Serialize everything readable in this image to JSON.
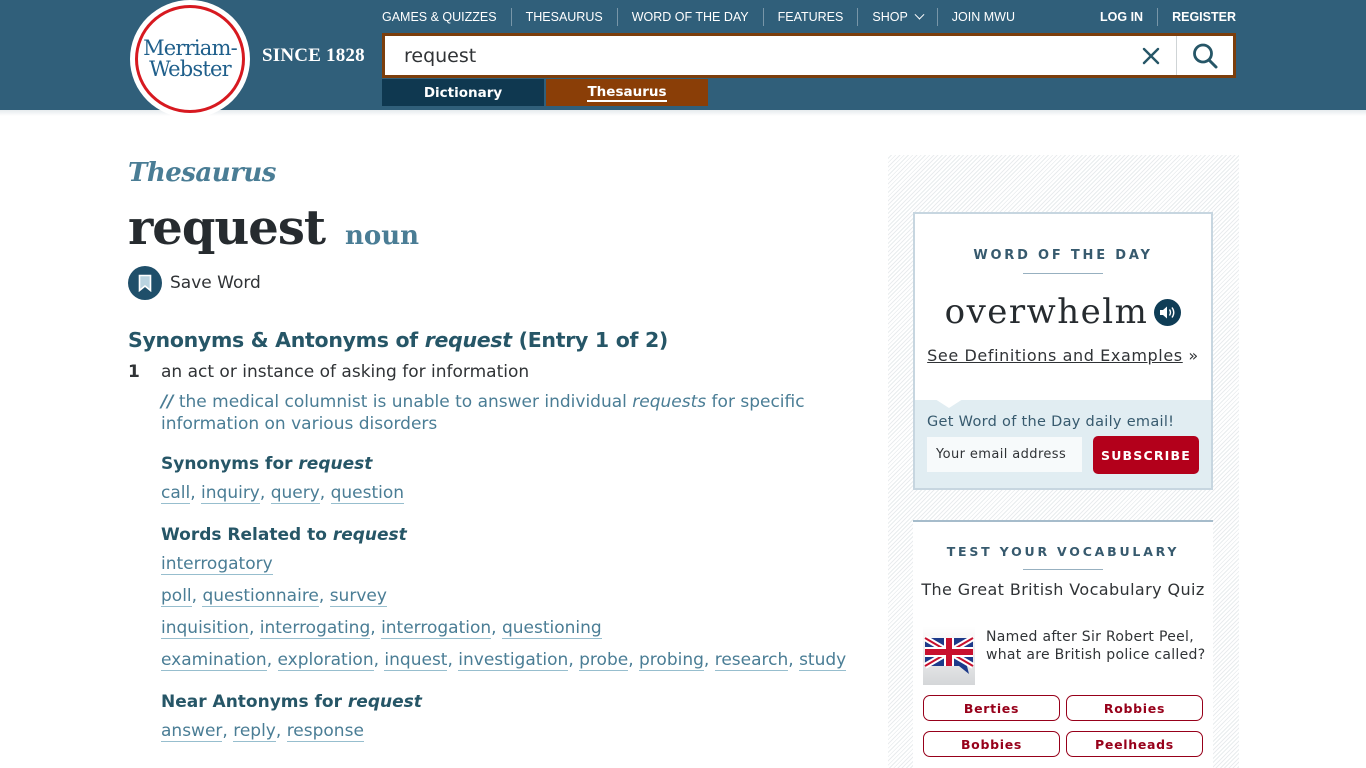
{
  "header": {
    "logo_line1": "Merriam-",
    "logo_line2": "Webster",
    "since": "SINCE 1828",
    "nav": [
      "GAMES & QUIZZES",
      "THESAURUS",
      "WORD OF THE DAY",
      "FEATURES",
      "SHOP",
      "JOIN MWU"
    ],
    "auth": {
      "login": "LOG IN",
      "register": "REGISTER"
    },
    "search": {
      "value": "request"
    },
    "tabs": {
      "dictionary": "Dictionary",
      "thesaurus": "Thesaurus",
      "active": "thesaurus"
    },
    "colors": {
      "bar": "#305f7a",
      "search_border": "#7c3e0c",
      "tab_dictionary": "#0f3850",
      "tab_thesaurus": "#8a3e07"
    }
  },
  "main": {
    "section_label": "Thesaurus",
    "headword": "request",
    "part_of_speech": "noun",
    "save_label": "Save Word",
    "entry_heading": {
      "prefix": "Synonyms & Antonyms of ",
      "word": "request",
      "suffix": " (Entry 1 of 2)"
    },
    "sense": {
      "number": "1",
      "definition": "an act or instance of asking for information",
      "example": {
        "slashes": "//",
        "before": " the medical columnist is unable to answer individual ",
        "emph": "requests",
        "after": " for specific information on various disorders"
      }
    },
    "synonyms": {
      "title_prefix": "Synonyms for ",
      "title_word": "request",
      "lines": [
        [
          "call",
          "inquiry",
          "query",
          "question"
        ]
      ]
    },
    "related": {
      "title_prefix": "Words Related to ",
      "title_word": "request",
      "lines": [
        [
          "interrogatory"
        ],
        [
          "poll",
          "questionnaire",
          "survey"
        ],
        [
          "inquisition",
          "interrogating",
          "interrogation",
          "questioning"
        ],
        [
          "examination",
          "exploration",
          "inquest",
          "investigation",
          "probe",
          "probing",
          "research",
          "study"
        ]
      ]
    },
    "near_antonyms": {
      "title_prefix": "Near Antonyms for ",
      "title_word": "request",
      "lines": [
        [
          "answer",
          "reply",
          "response"
        ]
      ]
    }
  },
  "sidebar": {
    "wotd": {
      "title": "WORD OF THE DAY",
      "word": "overwhelm",
      "link": "See Definitions and Examples",
      "link_suffix": " »",
      "signup_text": "Get Word of the Day daily email!",
      "email_placeholder": "Your email address",
      "subscribe": "SUBSCRIBE"
    },
    "vocab": {
      "title": "TEST YOUR VOCABULARY",
      "quiz_name": "The Great British Vocabulary Quiz",
      "question": "Named after Sir Robert Peel, what are British police called?",
      "answers": [
        "Berties",
        "Robbies",
        "Bobbies",
        "Peelheads"
      ]
    }
  }
}
